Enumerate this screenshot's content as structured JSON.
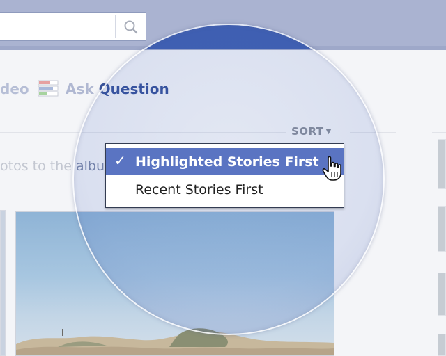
{
  "search": {
    "value": "",
    "icon": "search-icon"
  },
  "composer": {
    "video_partial_label": "deo",
    "ask_question": {
      "prefix": "Ask ",
      "lens_part": "Question",
      "icon": "question-list-icon"
    }
  },
  "sort": {
    "label": "SORT",
    "caret_icon": "caret-down-icon",
    "options": [
      {
        "label": "Highlighted Stories First",
        "selected": true,
        "check": "✓"
      },
      {
        "label": "Recent Stories First",
        "selected": false
      }
    ]
  },
  "album": {
    "partial_text_faded": "otos to the ",
    "partial_text_lens": "albu"
  },
  "colors": {
    "topbar": "#aab3d1",
    "accent": "#5a74c2",
    "lens_blue": "#3f5fb0",
    "link_blue": "#36519a"
  }
}
